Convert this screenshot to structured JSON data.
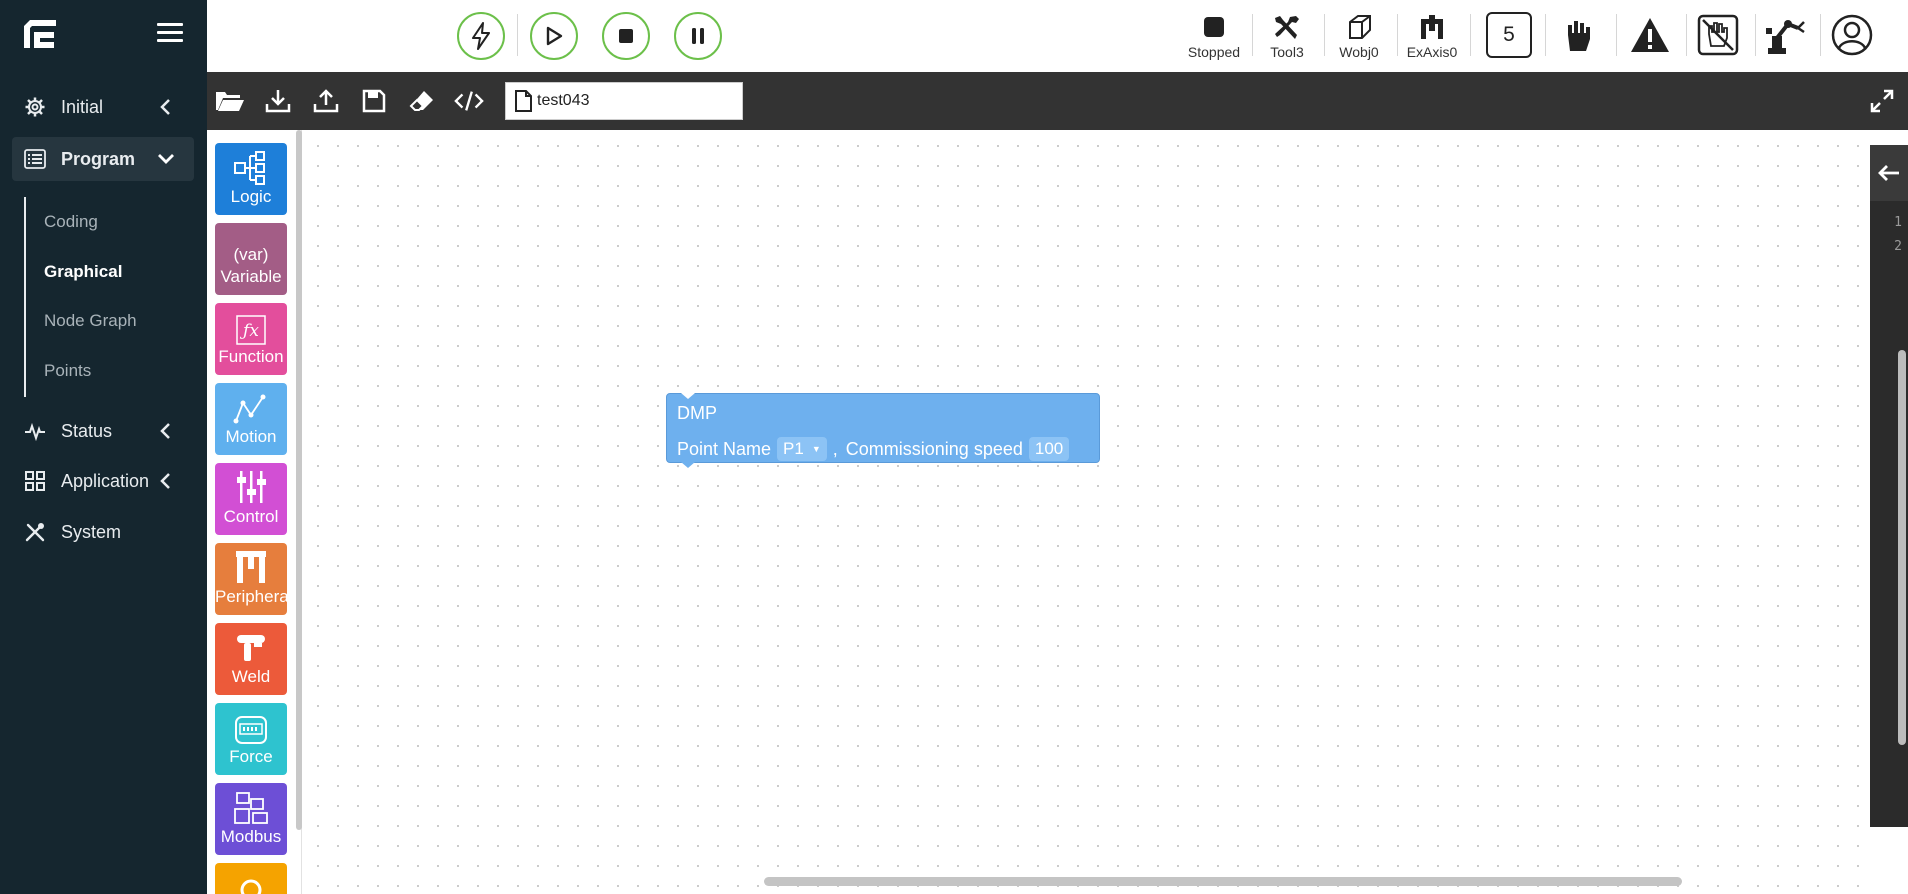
{
  "sidebar": {
    "nav": [
      {
        "label": "Initial"
      },
      {
        "label": "Program"
      },
      {
        "label": "Status"
      },
      {
        "label": "Application"
      },
      {
        "label": "System"
      }
    ],
    "program_sub": [
      "Coding",
      "Graphical",
      "Node Graph",
      "Points"
    ],
    "active_sub": "Graphical"
  },
  "topbar": {
    "status": {
      "label": "Stopped"
    },
    "tool": {
      "label": "Tool3"
    },
    "wobj": {
      "label": "Wobj0"
    },
    "exaxis": {
      "label": "ExAxis0"
    },
    "speed_level": "5"
  },
  "filebar": {
    "file_name": "test043"
  },
  "toolbox": {
    "categories": [
      {
        "label": "Logic",
        "color": "#1e7fd9"
      },
      {
        "label": "Variable",
        "color": "#a35d86",
        "icon_text": "(var)"
      },
      {
        "label": "Function",
        "color": "#e34e9c"
      },
      {
        "label": "Motion",
        "color": "#5fb0ee"
      },
      {
        "label": "Control",
        "color": "#d24fd4"
      },
      {
        "label": "Peripheral",
        "color": "#e67e3d"
      },
      {
        "label": "Weld",
        "color": "#ec5a3a"
      },
      {
        "label": "Force",
        "color": "#2ec3cf"
      },
      {
        "label": "Modbus",
        "color": "#6d4fd6"
      }
    ]
  },
  "block": {
    "title": "DMP",
    "point_label": "Point Name",
    "point_value": "P1",
    "separator": ",",
    "speed_label": "Commissioning speed",
    "speed_value": "100"
  },
  "code_panel": {
    "line_numbers": [
      "1",
      "2"
    ]
  }
}
